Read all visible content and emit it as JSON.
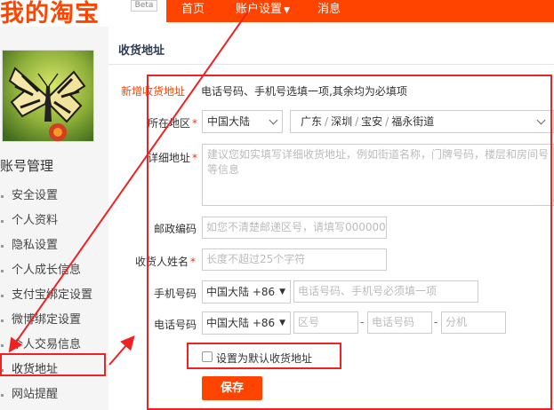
{
  "header": {
    "logo_text": "我的淘宝",
    "beta": "Beta",
    "nav": {
      "home": "首页",
      "account": "账户设置",
      "messages": "消息"
    }
  },
  "sidebar": {
    "title": "账号管理",
    "items": [
      {
        "label": "安全设置"
      },
      {
        "label": "个人资料"
      },
      {
        "label": "隐私设置"
      },
      {
        "label": "个人成长信息"
      },
      {
        "label": "支付宝绑定设置"
      },
      {
        "label": "微博绑定设置"
      },
      {
        "label": "个人交易信息"
      },
      {
        "label": "收货地址"
      },
      {
        "label": "网站提醒"
      }
    ]
  },
  "main": {
    "title": "收货地址",
    "new_label": "新增收货地址",
    "hint": "电话号码、手机号选填一项,其余均为必填项",
    "form": {
      "region_label": "所在地区",
      "region_country": "中国大陆",
      "region_province": "广东",
      "region_city": "深圳",
      "region_district": "宝安",
      "region_street": "福永街道",
      "detail_label": "详细地址",
      "detail_placeholder": "建议您如实填写详细收货地址，例如街道名称，门牌号码，楼层和房间号等信息",
      "zip_label": "邮政编码",
      "zip_placeholder": "如您不清楚邮递区号，请填写000000",
      "name_label": "收货人姓名",
      "name_placeholder": "长度不超过25个字符",
      "mobile_label": "手机号码",
      "mobile_country": "中国大陆 +86",
      "mobile_placeholder": "电话号码、手机号必须填一项",
      "phone_label": "电话号码",
      "phone_country": "中国大陆 +86",
      "phone_area_placeholder": "区号",
      "phone_number_placeholder": "电话号码",
      "phone_ext_placeholder": "分机",
      "phone_dash": "-",
      "default_label": "设置为默认收货地址",
      "save_label": "保存"
    }
  },
  "colors": {
    "brand": "#ff4400",
    "annotation": "#e22222"
  }
}
